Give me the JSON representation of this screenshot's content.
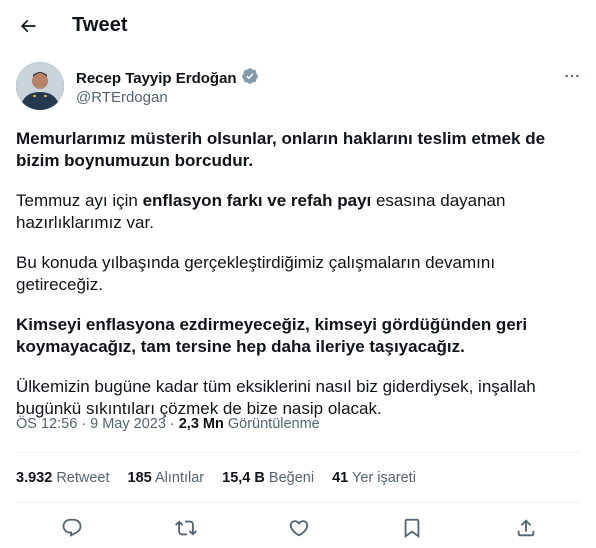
{
  "header": {
    "title": "Tweet"
  },
  "author": {
    "name": "Recep Tayyip Erdoğan",
    "handle": "@RTErdogan",
    "verified_color": "#829aab"
  },
  "tweet": {
    "p1": "Memurlarımız müsterih olsunlar, onların haklarını teslim etmek de bizim boynumuzun borcudur.",
    "p2_pre": "Temmuz ayı için ",
    "p2_bold": "enflasyon farkı ve refah payı",
    "p2_post": " esasına dayanan hazırlıklarımız var.",
    "p3": "Bu konuda yılbaşında gerçekleştirdiğimiz çalışmaların devamını getireceğiz.",
    "p4": "Kimseyi enflasyona ezdirmeyeceğiz, kimseyi gördüğünden geri koymayacağız, tam tersine hep daha ileriye taşıyacağız.",
    "p5": "Ülkemizin bugüne kadar tüm eksiklerini nasıl biz giderdiysek, inşallah bugünkü sıkıntıları çözmek de bize nasip olacak."
  },
  "meta": {
    "time": "ÖS 12:56",
    "sep": "·",
    "date": "9 May 2023",
    "views_count": "2,3 Mn",
    "views_label": "Görüntülenme"
  },
  "stats": [
    {
      "count": "3.932",
      "label": "Retweet"
    },
    {
      "count": "185",
      "label": "Alıntılar"
    },
    {
      "count": "15,4 B",
      "label": "Beğeni"
    },
    {
      "count": "41",
      "label": "Yer işareti"
    }
  ],
  "actions": [
    "reply-icon",
    "retweet-icon",
    "like-icon",
    "bookmark-icon",
    "share-icon"
  ],
  "colors": {
    "text": "#0f1419",
    "secondary": "#536471",
    "divider": "#eff3f4"
  }
}
